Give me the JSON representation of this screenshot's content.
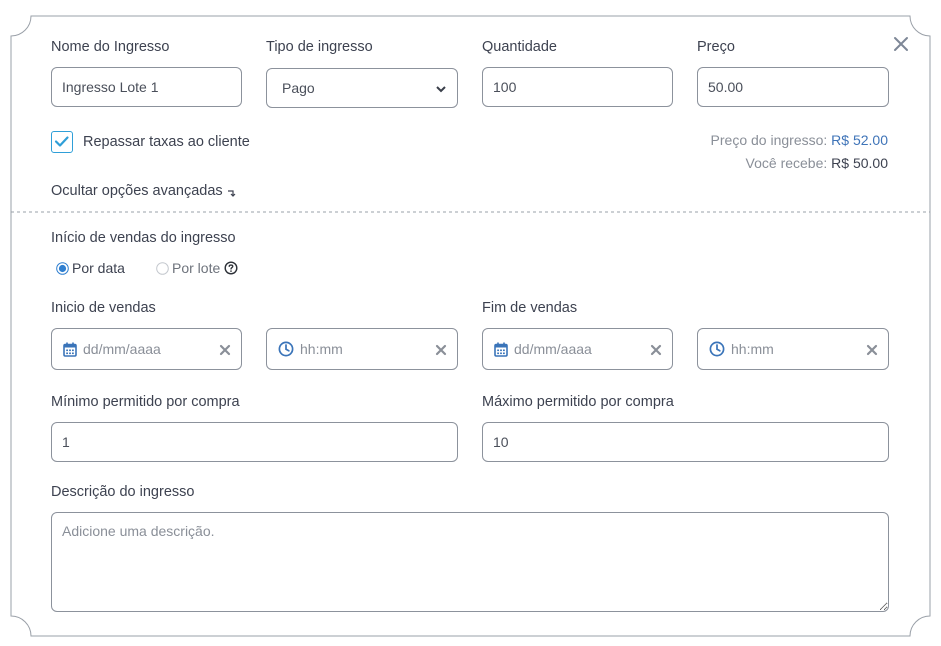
{
  "form": {
    "name": {
      "label": "Nome do Ingresso",
      "value": "Ingresso Lote 1"
    },
    "type": {
      "label": "Tipo de ingresso",
      "value": "Pago"
    },
    "quantity": {
      "label": "Quantidade",
      "value": "100"
    },
    "price": {
      "label": "Preço",
      "value": "50.00"
    },
    "pass_fees": {
      "label": "Repassar taxas ao cliente",
      "checked": true
    },
    "price_summary": {
      "ticket_price_label": "Preço do ingresso:",
      "ticket_price_value": "R$ 52.00",
      "you_receive_label": "Você recebe:",
      "you_receive_value": "R$ 50.00"
    },
    "advanced_toggle": "Ocultar opções avançadas",
    "sales_start_mode": {
      "label": "Início de vendas do ingresso",
      "option_date": "Por data",
      "option_batch": "Por lote",
      "selected": "date"
    },
    "sales_start": {
      "label": "Inicio de vendas",
      "date_placeholder": "dd/mm/aaaa",
      "time_placeholder": "hh:mm"
    },
    "sales_end": {
      "label": "Fim de vendas",
      "date_placeholder": "dd/mm/aaaa",
      "time_placeholder": "hh:mm"
    },
    "min_per_purchase": {
      "label": "Mínimo permitido por compra",
      "value": "1"
    },
    "max_per_purchase": {
      "label": "Máximo permitido por compra",
      "value": "10"
    },
    "description": {
      "label": "Descrição do ingresso",
      "placeholder": "Adicione uma descrição."
    }
  },
  "icons": {
    "close": "close-icon",
    "check": "check-icon",
    "calendar": "calendar-icon",
    "clock": "clock-icon",
    "clear": "clear-x-icon",
    "help": "help-circle-icon",
    "chevron": "chevron-down-icon"
  },
  "colors": {
    "accent": "#2f9fd8",
    "price_blue": "#3f74b8",
    "icon_blue": "#3a74b9",
    "border": "#8c929c"
  }
}
